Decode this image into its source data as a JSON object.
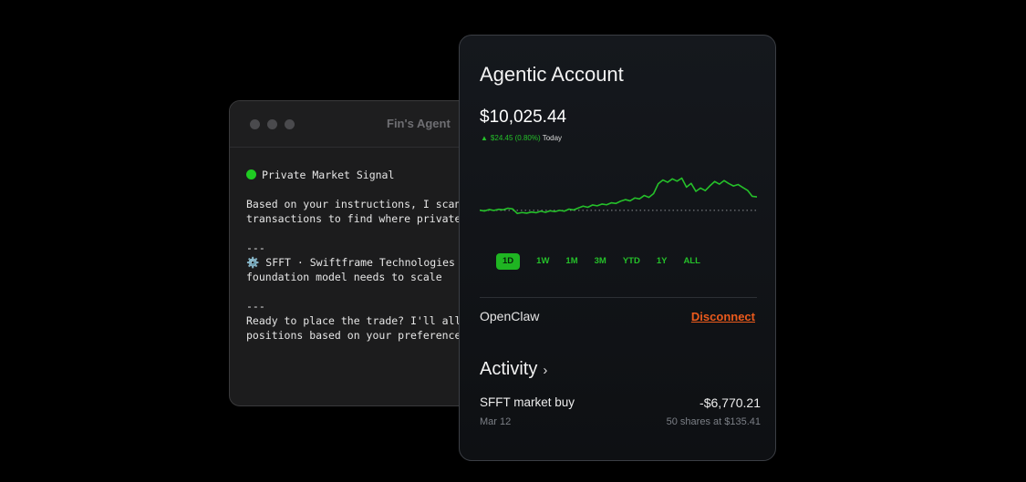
{
  "terminal": {
    "title": "Fin's Agent",
    "signal_heading": "Private Market Signal",
    "paragraph_line_1": "Based on your instructions, I scann",
    "paragraph_line_2": "transactions to find where private",
    "separator": "---",
    "ticker_line_1": "SFFT · Swiftframe Technologies ·",
    "ticker_line_2": "foundation model needs to scale",
    "prompt_line_1": "Ready to place the trade? I'll allo",
    "prompt_line_2": "positions based on your preferences",
    "status_color": "#1fcb22"
  },
  "account": {
    "title": "Agentic Account",
    "balance": "$10,025.44",
    "change_value": "$24.45 (0.80%)",
    "change_period": "Today",
    "accent_color": "#25c02a",
    "ranges": [
      "1D",
      "1W",
      "1M",
      "3M",
      "YTD",
      "1Y",
      "ALL"
    ],
    "selected_range": "1D",
    "integration_name": "OpenClaw",
    "disconnect_label": "Disconnect",
    "activity_heading": "Activity",
    "transaction": {
      "name": "SFFT market buy",
      "amount": "-$6,770.21",
      "date": "Mar 12",
      "detail": "50 shares at $135.41"
    }
  },
  "chart_data": {
    "type": "line",
    "title": "",
    "xlabel": "",
    "ylabel": "",
    "grid": false,
    "baseline": 10001.0,
    "ylim": [
      9985,
      10045
    ],
    "series": [
      {
        "values": [
          10001.2,
          10000.4,
          10001.8,
          10000.9,
          10002.0,
          10001.5,
          10003.1,
          10002.4,
          9998.0,
          9998.9,
          9998.3,
          9999.4,
          9998.7,
          10000.2,
          9999.1,
          10000.6,
          9999.8,
          10001.0,
          10000.2,
          10002.2,
          10001.4,
          10003.3,
          10005.1,
          10004.0,
          10006.2,
          10005.4,
          10007.1,
          10006.4,
          10008.3,
          10007.7,
          10009.9,
          10011.4,
          10010.2,
          10013.0,
          10012.1,
          10015.4,
          10013.6,
          10017.2,
          10026.8,
          10030.4,
          10028.2,
          10031.5,
          10029.3,
          10032.2,
          10023.5,
          10027.1,
          10019.4,
          10022.6,
          10020.1,
          10024.8,
          10028.9,
          10026.4,
          10029.8,
          10027.0,
          10024.6,
          10026.0,
          10023.1,
          10020.4,
          10014.6,
          10014.1
        ]
      }
    ]
  }
}
